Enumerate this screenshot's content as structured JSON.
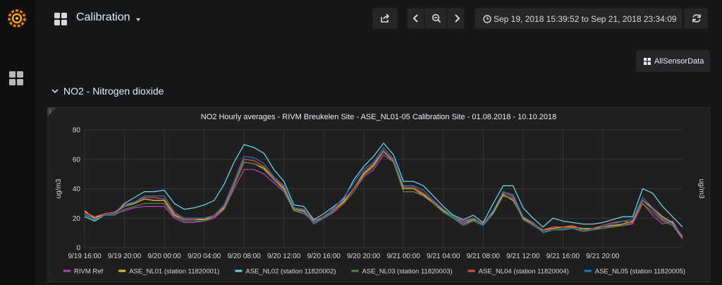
{
  "colors": {
    "background": "#161719",
    "panel": "#1f1f20",
    "accent": "#eb7b18"
  },
  "sidebar": {
    "icons": [
      "grafana-logo",
      "dashboards-icon"
    ]
  },
  "header": {
    "title": "Calibration",
    "buttons": [
      "share-icon",
      "time-back-icon",
      "zoom-out-icon",
      "time-forward-icon",
      "refresh-icon"
    ],
    "time_range": "Sep 19, 2018 15:39:52 to Sep 21, 2018 23:34:09"
  },
  "links": {
    "all_sensor_data": "AllSensorData"
  },
  "row": {
    "title": "NO2 - Nitrogen dioxide"
  },
  "panel": {
    "info": "i"
  },
  "chart_data": {
    "type": "line",
    "title": "NO2 Hourly averages - RIVM Breukelen Site - ASE_NL01-05 Calibration Site - 01.08.2018 - 10.10.2018",
    "ylabel": "ug/m3",
    "y2label": "ug/m3",
    "ylim": [
      0,
      80
    ],
    "yticks": [
      "0",
      "20",
      "40",
      "60",
      "80"
    ],
    "grid": true,
    "x_hours": [
      0,
      2,
      4,
      6,
      8,
      10,
      12,
      14,
      16,
      18,
      20,
      22,
      24,
      26,
      28,
      30,
      32,
      34,
      36,
      38,
      40,
      42,
      44,
      46,
      48,
      50,
      52,
      54,
      56,
      58,
      60,
      62,
      64,
      66,
      68,
      70,
      72,
      74,
      76,
      78,
      80,
      82,
      84,
      86,
      88,
      90,
      92,
      94,
      96,
      98,
      100,
      102,
      104,
      106,
      108,
      110,
      112,
      114,
      116,
      118,
      120
    ],
    "x_tick_labels": [
      "9/19 16:00",
      "9/19 20:00",
      "9/20 00:00",
      "9/20 04:00",
      "9/20 08:00",
      "9/20 12:00",
      "9/20 16:00",
      "9/20 20:00",
      "9/21 00:00",
      "9/21 04:00",
      "9/21 08:00",
      "9/21 12:00",
      "9/21 16:00",
      "9/21 20:00"
    ],
    "legend_position": "bottom-left",
    "series": [
      {
        "name": "RIVM Ref",
        "color": "#b33fb7",
        "values": [
          24,
          20,
          22,
          23,
          25,
          27,
          28,
          28,
          28,
          20,
          17,
          17,
          18,
          20,
          26,
          40,
          53,
          53,
          50,
          44,
          38,
          25,
          23,
          18,
          20,
          24,
          30,
          38,
          48,
          53,
          63,
          58,
          38,
          38,
          36,
          31,
          26,
          21,
          17,
          20,
          16,
          25,
          35,
          34,
          20,
          17,
          11,
          12,
          12,
          13,
          11,
          12,
          14,
          15,
          15,
          16,
          30,
          22,
          16,
          18,
          7
        ]
      },
      {
        "name": "ASE_NL01 (station 11820001)",
        "color": "#eab839",
        "values": [
          25,
          20,
          23,
          24,
          28,
          30,
          33,
          32,
          32,
          22,
          19,
          19,
          19,
          21,
          27,
          42,
          58,
          57,
          54,
          46,
          40,
          26,
          25,
          18,
          21,
          26,
          31,
          40,
          50,
          56,
          66,
          58,
          40,
          40,
          36,
          30,
          25,
          21,
          16,
          19,
          16,
          24,
          36,
          32,
          20,
          16,
          12,
          13,
          14,
          14,
          13,
          13,
          14,
          15,
          16,
          18,
          32,
          27,
          21,
          17,
          6
        ]
      },
      {
        "name": "ASE_NL02 (station 11820002)",
        "color": "#6ed0e0",
        "values": [
          21,
          18,
          22,
          23,
          30,
          34,
          38,
          38,
          39,
          30,
          26,
          27,
          29,
          32,
          43,
          58,
          70,
          68,
          64,
          53,
          45,
          29,
          28,
          19,
          23,
          28,
          33,
          46,
          55,
          62,
          71,
          63,
          45,
          45,
          42,
          35,
          28,
          22,
          19,
          22,
          17,
          30,
          42,
          42,
          27,
          20,
          14,
          20,
          18,
          17,
          16,
          16,
          17,
          19,
          21,
          21,
          40,
          37,
          28,
          21,
          14
        ]
      },
      {
        "name": "ASE_NL03 (station 11820003)",
        "color": "#508642",
        "values": [
          23,
          19,
          22,
          22,
          26,
          28,
          30,
          30,
          30,
          21,
          18,
          18,
          18,
          21,
          26,
          42,
          58,
          57,
          53,
          46,
          39,
          25,
          24,
          17,
          20,
          25,
          30,
          38,
          49,
          55,
          65,
          58,
          38,
          38,
          35,
          30,
          24,
          20,
          15,
          18,
          15,
          23,
          35,
          33,
          19,
          15,
          11,
          12,
          12,
          13,
          11,
          12,
          13,
          14,
          15,
          17,
          30,
          24,
          18,
          15,
          6
        ]
      },
      {
        "name": "ASE_NL04 (station 11820004)",
        "color": "#e24d42",
        "values": [
          24,
          21,
          23,
          24,
          29,
          31,
          34,
          34,
          33,
          23,
          19,
          19,
          20,
          21,
          28,
          43,
          60,
          59,
          55,
          47,
          41,
          27,
          26,
          18,
          21,
          26,
          32,
          40,
          51,
          57,
          66,
          59,
          41,
          41,
          37,
          31,
          26,
          21,
          18,
          20,
          16,
          25,
          37,
          35,
          21,
          16,
          12,
          14,
          14,
          15,
          12,
          13,
          15,
          17,
          18,
          17,
          32,
          26,
          19,
          16,
          6
        ]
      },
      {
        "name": "ASE_NL05 (station 11820005)",
        "color": "#1f78c1",
        "values": [
          22,
          19,
          22,
          23,
          28,
          31,
          35,
          35,
          35,
          24,
          20,
          20,
          20,
          22,
          29,
          45,
          62,
          61,
          57,
          48,
          42,
          27,
          26,
          16,
          20,
          27,
          34,
          44,
          53,
          58,
          68,
          60,
          42,
          42,
          39,
          32,
          26,
          21,
          16,
          20,
          15,
          25,
          38,
          36,
          21,
          17,
          10,
          12,
          13,
          13,
          12,
          12,
          14,
          16,
          18,
          19,
          34,
          27,
          20,
          16,
          8
        ]
      }
    ]
  }
}
